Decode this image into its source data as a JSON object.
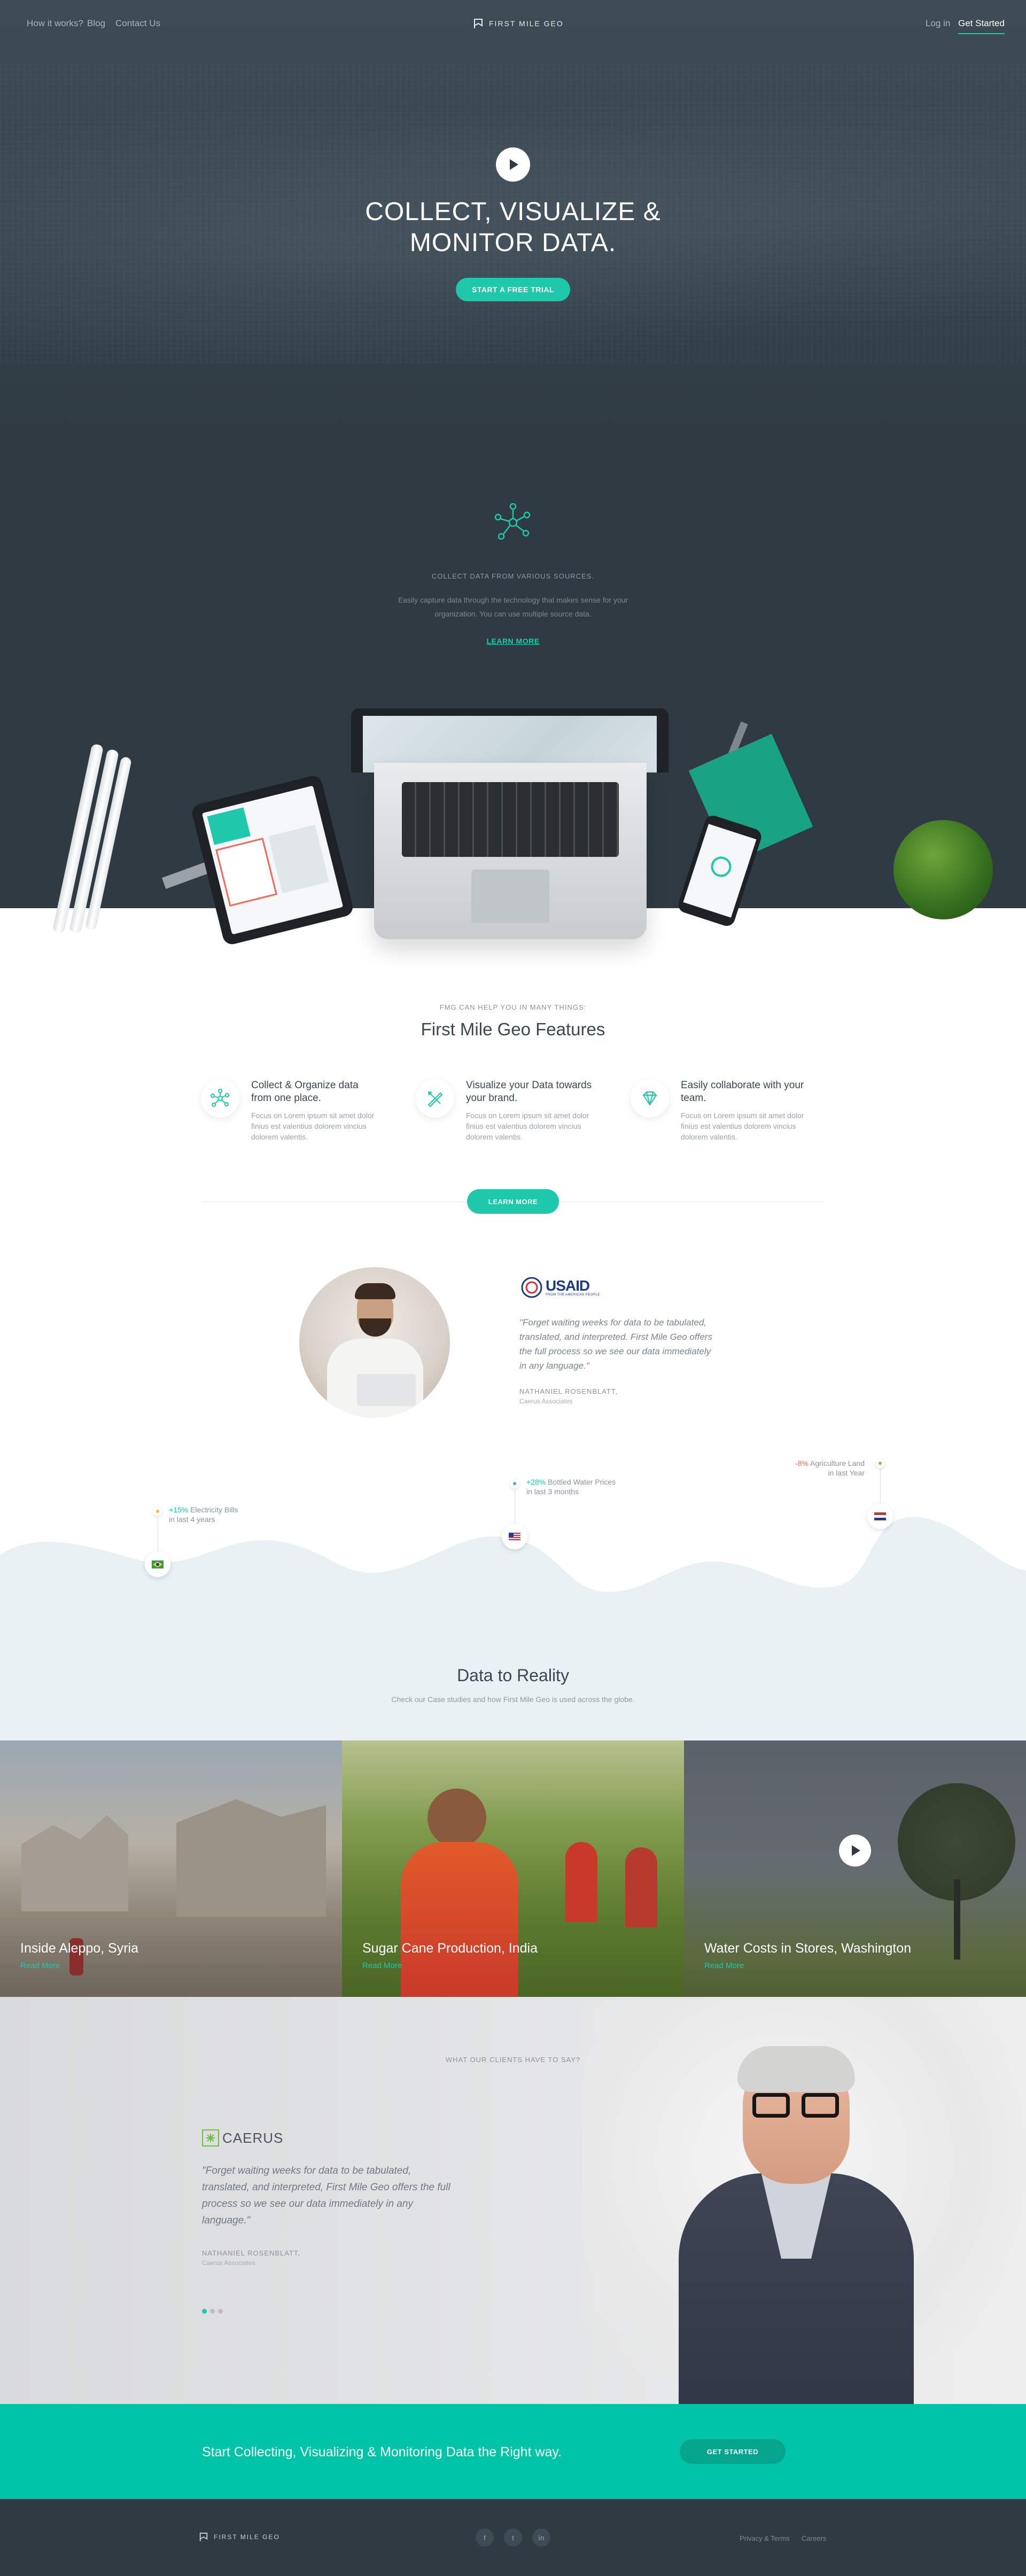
{
  "nav": {
    "links": [
      "How it works?",
      "Blog",
      "Contact Us"
    ],
    "brand": "FIRST MILE GEO",
    "login": "Log in",
    "get_started": "Get Started"
  },
  "hero": {
    "title_line1": "COLLECT, VISUALIZE &",
    "title_line2": "MONITOR DATA.",
    "cta": "START A FREE TRIAL"
  },
  "collect": {
    "label": "COLLECT DATA FROM VARIOUS SOURCES.",
    "desc_line1": "Easily capture data through the technology that makes sense for your",
    "desc_line2": "organization. You can use multiple source data.",
    "learn_more": "LEARN MORE"
  },
  "features": {
    "label": "FMG CAN HELP YOU IN MANY THINGS:",
    "title": "First Mile Geo Features",
    "items": [
      {
        "title": "Collect & Organize data from one place.",
        "text": "Focus on Lorem ipsum sit amet dolor finius est valentius dolorem vincius dolorem valentis.",
        "icon": "network-icon"
      },
      {
        "title": "Visualize your Data towards your brand.",
        "text": "Focus on Lorem ipsum sit amet dolor finius est valentius dolorem vincius dolorem valentis.",
        "icon": "tools-icon"
      },
      {
        "title": "Easily collaborate with your team.",
        "text": "Focus on Lorem ipsum sit amet dolor finius est valentius dolorem vincius dolorem valentis.",
        "icon": "diamond-icon"
      }
    ],
    "learn_more": "LEARN MORE"
  },
  "testimonial": {
    "logo_text": "USAID",
    "logo_sub": "FROM THE AMERICAN PEOPLE",
    "quote_lines": [
      "\"Forget waiting weeks for data to be tabulated,",
      "translated, and interpreted. First Mile Geo offers",
      "the full process so we see our data immediately",
      "in any language.\""
    ],
    "author": "NATHANIEL ROSENBLATT,",
    "company": "Caerus Associates"
  },
  "stats": [
    {
      "value": "+15%",
      "label_1": "Electricity Bills",
      "label_2": "in last 4 years",
      "color": "#1dc9aa"
    },
    {
      "value": "+28%",
      "label_1": "Bottled Water Prices",
      "label_2": "in last 3 months",
      "color": "#1dc9aa"
    },
    {
      "value": "-8%",
      "label_1": "Agriculture Land",
      "label_2": "in last Year",
      "color": "#f06a5a"
    }
  ],
  "reality": {
    "title": "Data to Reality",
    "subtitle": "Check our Case studies and how First Mile Geo is used across the globe."
  },
  "cases": [
    {
      "title": "Inside Aleppo, Syria",
      "link": "Read More"
    },
    {
      "title": "Sugar Cane Production, India",
      "link": "Read More"
    },
    {
      "title": "Water Costs in Stores, Washington",
      "link": "Read More"
    }
  ],
  "clients": {
    "label": "WHAT OUR CLIENTS HAVE TO SAY?",
    "logo_text": "CAERUS",
    "quote_lines": [
      "\"Forget waiting weeks for data to be tabulated,",
      "translated, and interpreted, First Mile Geo offers the full",
      "process so we see our data immediately in any",
      "language.\""
    ],
    "author": "NATHANIEL ROSENBLATT,",
    "company": "Caerus Associates"
  },
  "cta": {
    "text": "Start Collecting, Visualizing & Monitoring Data the Right way.",
    "button": "GET STARTED"
  },
  "footer": {
    "brand": "FIRST MILE GEO",
    "social": [
      "f",
      "t",
      "in"
    ],
    "links": [
      "Privacy & Terms",
      "Careers"
    ]
  },
  "colors": {
    "accent": "#1dc9aa",
    "dark": "#2f3a42",
    "negative": "#f06a5a"
  }
}
